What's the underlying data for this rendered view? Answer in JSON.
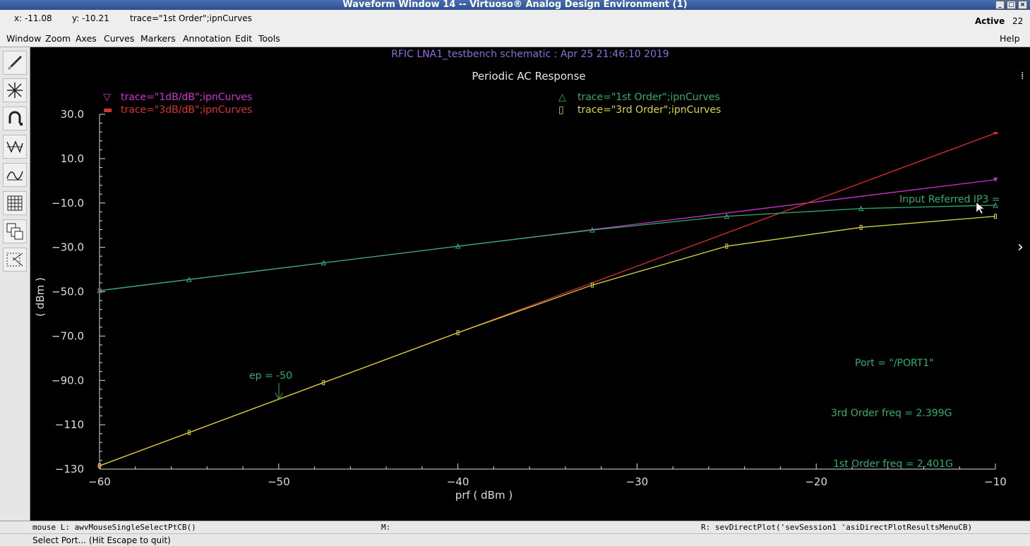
{
  "window": {
    "title": "Waveform Window 14 -- Virtuoso® Analog Design Environment (1)",
    "buttons": [
      "_",
      "□",
      "×"
    ],
    "coords_x": "x: -11.08",
    "coords_y": "y: -10.21",
    "coords_trace": "trace=\"1st Order\";ipnCurves",
    "active_label": "Active",
    "active_num": "22"
  },
  "menu": {
    "items": [
      "Window",
      "Zoom",
      "Axes",
      "Curves",
      "Markers",
      "Annotation",
      "Edit",
      "Tools"
    ],
    "help": "Help"
  },
  "toolbar": {
    "icons": [
      "pencil-icon",
      "zoom-fit-icon",
      "magnet-icon",
      "strip-split-icon",
      "waveform-composite-icon",
      "table-icon",
      "multi-window-icon",
      "scissors-icon"
    ]
  },
  "plot": {
    "header": "RFIC LNA1_testbench schematic : Apr 25 21:46:10 2019",
    "title": "Periodic AC Response",
    "legend": [
      {
        "marker": "▽",
        "text": "trace=\"1dB/dB\";ipnCurves",
        "color": "#cc33cc"
      },
      {
        "marker": "▬",
        "text": "trace=\"3dB/dB\";ipnCurves",
        "color": "#d93030"
      },
      {
        "marker": "△",
        "text": "trace=\"1st Order\";ipnCurves",
        "color": "#2fae6e"
      },
      {
        "marker": "▯",
        "text": "trace=\"3rd Order\";ipnCurves",
        "color": "#d8d83a"
      }
    ],
    "annotations": {
      "ip3": "Input Referred IP3 =",
      "ep": "ep = -50",
      "port": "Port = \"/PORT1\"",
      "freq3": "3rd Order freq = 2.399G",
      "freq1": "1st Order freq = 2.401G"
    },
    "side_glyphs": [
      "⁞",
      "›"
    ]
  },
  "chart_data": {
    "type": "line",
    "title": "Periodic AC Response",
    "xlabel": "prf ( dBm )",
    "ylabel": "( dBm )",
    "xlim": [
      -60,
      -10
    ],
    "ylim": [
      -130,
      30
    ],
    "x_ticks": [
      "−60",
      "−50",
      "−40",
      "−30",
      "−20",
      "−10"
    ],
    "y_ticks": [
      "−130",
      "−110",
      "−90.0",
      "−70.0",
      "−50.0",
      "−30.0",
      "−10.0",
      "10.0",
      "30.0"
    ],
    "series": [
      {
        "name": "trace=\"1dB/dB\";ipnCurves",
        "color": "#cc33cc",
        "marker": "v",
        "x": [
          -60,
          -10
        ],
        "y": [
          -49.5,
          0.5
        ]
      },
      {
        "name": "trace=\"3dB/dB\";ipnCurves",
        "color": "#d93030",
        "marker": "-",
        "x": [
          -60,
          -10
        ],
        "y": [
          -128.5,
          21.5
        ]
      },
      {
        "name": "trace=\"1st Order\";ipnCurves",
        "color": "#2fae6e",
        "marker": "^",
        "x": [
          -60,
          -55,
          -47.5,
          -40,
          -32.5,
          -25,
          -17.5,
          -10
        ],
        "y": [
          -49.5,
          -44.5,
          -37,
          -29.5,
          -22.2,
          -16,
          -12.5,
          -11
        ]
      },
      {
        "name": "trace=\"3rd Order\";ipnCurves",
        "color": "#d8d83a",
        "marker": "o",
        "x": [
          -60,
          -55,
          -47.5,
          -40,
          -32.5,
          -25,
          -17.5,
          -10
        ],
        "y": [
          -128.5,
          -113.5,
          -91,
          -68.5,
          -47,
          -29.5,
          -21,
          -16
        ]
      }
    ]
  },
  "status": {
    "mouse_l": "mouse L: awvMouseSingleSelectPtCB()",
    "mouse_m": "M:",
    "mouse_r": "R: sevDirectPlot('sevSession1 'asiDirectPlotResultsMenuCB)",
    "prompt": "Select Port... (Hit Escape to quit)"
  }
}
